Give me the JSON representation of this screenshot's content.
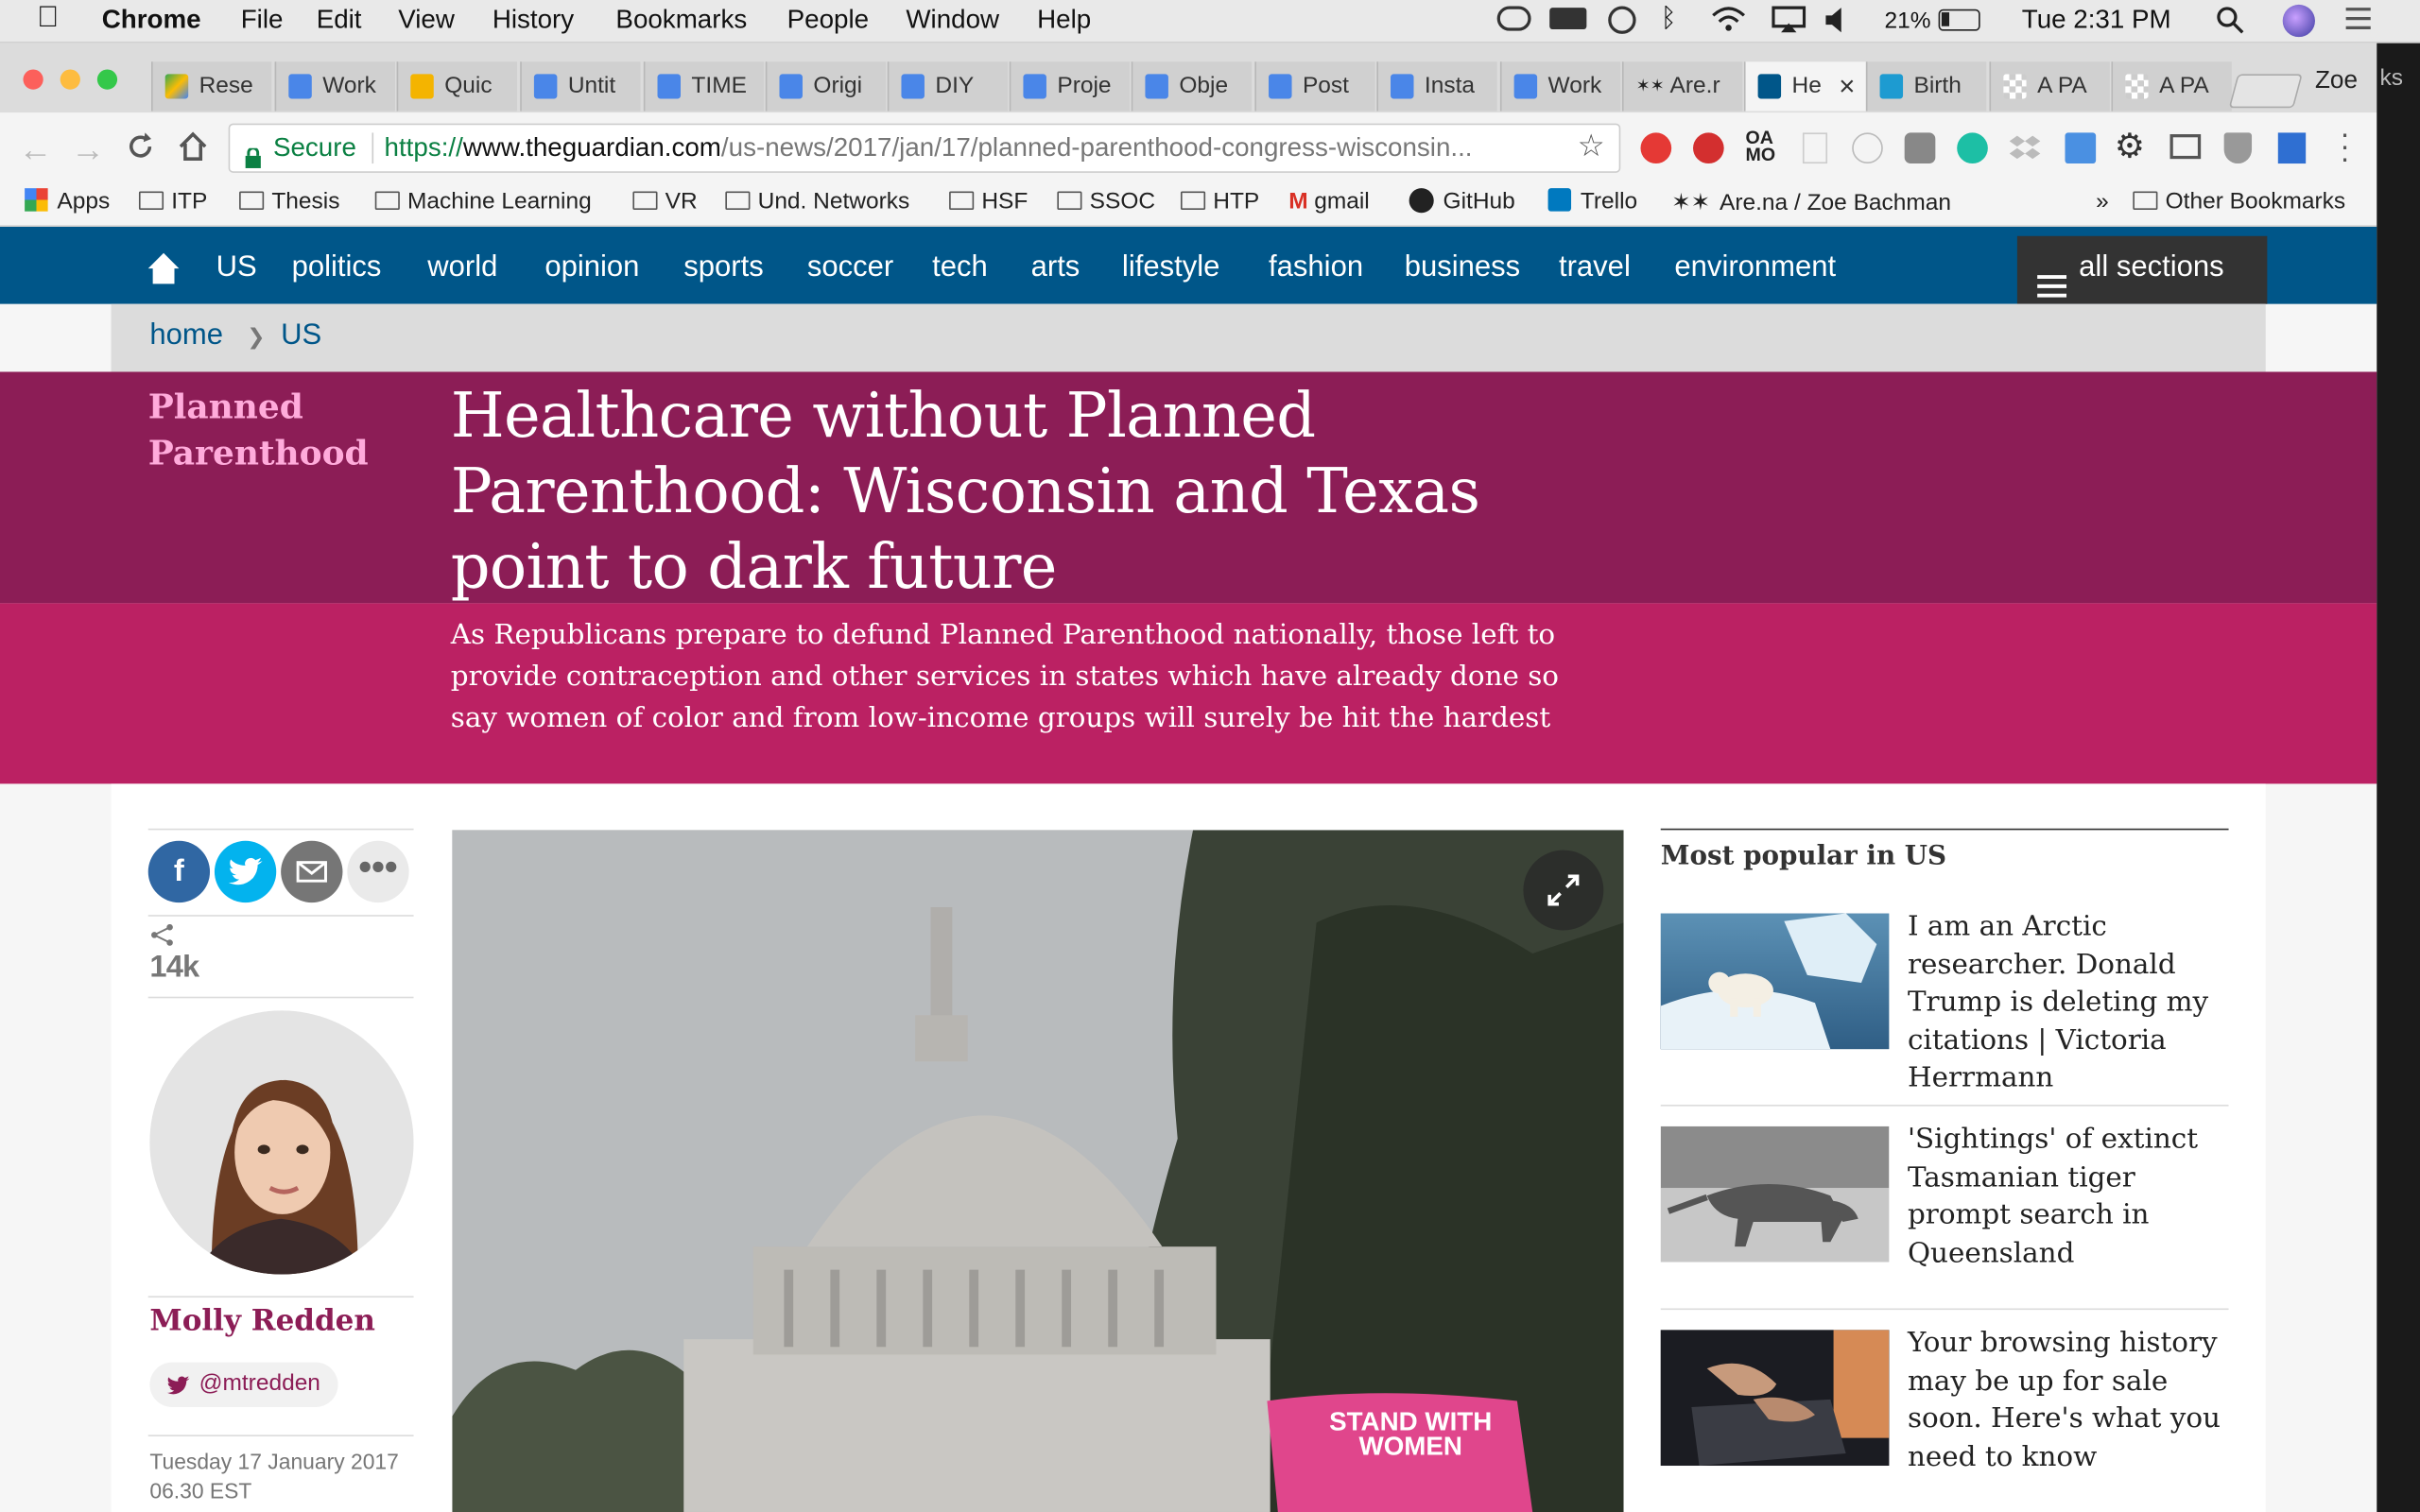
{
  "menubar": {
    "app": "Chrome",
    "items": [
      "File",
      "Edit",
      "View",
      "History",
      "Bookmarks",
      "People",
      "Window",
      "Help"
    ],
    "battery": "21%",
    "clock": "Tue 2:31 PM"
  },
  "tabs": [
    {
      "label": "Rese",
      "icon": "drive-icon"
    },
    {
      "label": "Work",
      "icon": "docs-icon"
    },
    {
      "label": "Quic",
      "icon": "slides-icon"
    },
    {
      "label": "Untit",
      "icon": "docs-icon"
    },
    {
      "label": "TIME",
      "icon": "docs-icon"
    },
    {
      "label": "Origi",
      "icon": "docs-icon"
    },
    {
      "label": "DIY",
      "icon": "docs-icon"
    },
    {
      "label": "Proje",
      "icon": "docs-icon"
    },
    {
      "label": "Obje",
      "icon": "docs-icon"
    },
    {
      "label": "Post",
      "icon": "docs-icon"
    },
    {
      "label": "Insta",
      "icon": "docs-icon"
    },
    {
      "label": "Work",
      "icon": "docs-icon"
    },
    {
      "label": "Are.r",
      "icon": "arena-icon"
    },
    {
      "label": "He",
      "icon": "guardian-icon"
    },
    {
      "label": "Birth",
      "icon": "b-icon"
    },
    {
      "label": "A PA",
      "icon": "checker-icon"
    },
    {
      "label": "A PA",
      "icon": "checker-icon"
    }
  ],
  "profile_name": "Zoe",
  "url": {
    "secure_label": "Secure",
    "scheme": "https://",
    "host": "www.theguardian.com",
    "path": "/us-news/2017/jan/17/planned-parenthood-congress-wisconsin..."
  },
  "bookmarks": [
    "Apps",
    "ITP",
    "Thesis",
    "Machine Learning",
    "VR",
    "Und. Networks",
    "HSF",
    "SSOC",
    "HTP",
    "gmail",
    "GitHub",
    "Trello",
    "Are.na / Zoe Bachman"
  ],
  "bookmarks_more": "»",
  "bookmarks_other": "Other Bookmarks",
  "nav": {
    "items": [
      "US",
      "politics",
      "world",
      "opinion",
      "sports",
      "soccer",
      "tech",
      "arts",
      "lifestyle",
      "fashion",
      "business",
      "travel",
      "environment"
    ],
    "all_sections": "all sections"
  },
  "breadcrumb": {
    "home": "home",
    "sep": "❯",
    "current": "US"
  },
  "article": {
    "section": "Planned Parenthood",
    "headline": "Healthcare without Planned Parenthood: Wisconsin and Texas point to dark future",
    "standfirst": "As Republicans prepare to defund Planned Parenthood nationally, those left to provide contraception and other services in states which have already done so say women of color and from low-income groups will surely be hit the hardest",
    "share_count": "14k",
    "author": "Molly Redden",
    "twitter": "@mtredden",
    "date": "Tuesday 17 January 2017",
    "time": "06.30 EST",
    "photo_sign": "STAND WITH WOMEN"
  },
  "most_popular": {
    "heading": "Most popular in US",
    "items": [
      {
        "title": "I am an Arctic researcher. Donald Trump is deleting my citations | Victoria Herrmann"
      },
      {
        "title": "'Sightings' of extinct Tasmanian tiger prompt search in Queensland"
      },
      {
        "title": "Your browsing history may be up for sale soon. Here's what you need to know"
      }
    ]
  },
  "colors": {
    "nav_blue": "#005689",
    "hero_dark": "#8c1d56",
    "hero_light": "#bb2163",
    "section_pink": "#ffabdb",
    "author_color": "#8c1d56"
  }
}
